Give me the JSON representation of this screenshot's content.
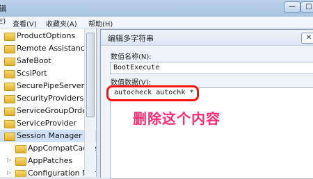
{
  "window": {
    "title_fragment": "辑",
    "minimize_glyph": "—",
    "maximize_glyph": "□"
  },
  "menu": {
    "items": [
      "E)",
      "查看(V)",
      "收藏夹(A)",
      "帮助(H)"
    ]
  },
  "tree": {
    "items": [
      {
        "label": "ProductOptions"
      },
      {
        "label": "Remote Assistance"
      },
      {
        "label": "SafeBoot"
      },
      {
        "label": "ScsiPort"
      },
      {
        "label": "SecurePipeServers"
      },
      {
        "label": "SecurityProviders"
      },
      {
        "label": "ServiceGroupOrder"
      },
      {
        "label": "ServiceProvider"
      },
      {
        "label": "Session Manager",
        "selected": true
      },
      {
        "label": "AppCompatCache"
      },
      {
        "label": "AppPatches"
      },
      {
        "label": "Configuration Manager"
      }
    ]
  },
  "dialog": {
    "title": "编辑多字符串",
    "close_glyph": "✕",
    "value_name_label": "数值名称(N):",
    "value_name": "BootExecute",
    "value_data_label": "数值数据(V):",
    "value_data": "autocheck autochk *"
  },
  "annotation": {
    "text": "删除这个内容",
    "color": "#ff2b6e"
  },
  "colors": {
    "highlight_border": "#ff1010",
    "selection": "#cfe1f6"
  }
}
